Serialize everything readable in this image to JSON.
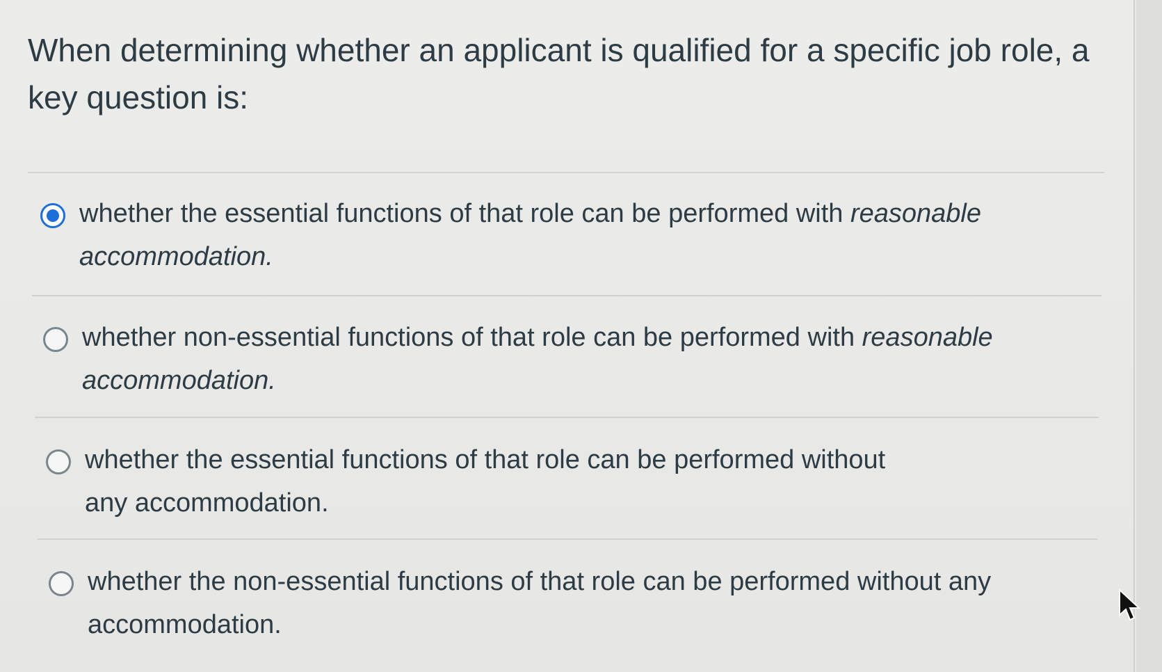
{
  "question": {
    "text": "When determining whether an applicant is qualified for a specific job role, a key question is:"
  },
  "answers": [
    {
      "selected": true,
      "text_before": "whether the essential functions of that role can be performed with ",
      "text_italic": "reasonable accommodation."
    },
    {
      "selected": false,
      "text_before": "whether non-essential functions of that role can be performed with ",
      "text_italic": "reasonable accommodation."
    },
    {
      "selected": false,
      "text_before": "whether the essential functions of that role can be performed without any accommodation.",
      "text_italic": ""
    },
    {
      "selected": false,
      "text_before": "whether the non-essential functions of that role can be performed without any accommodation.",
      "text_italic": ""
    }
  ],
  "colors": {
    "selected_radio": "#1b6fd6",
    "text": "#2d3b45"
  },
  "icons": {
    "radio_selected": "radio-selected-icon",
    "radio_unselected": "radio-unselected-icon",
    "cursor": "mouse-cursor-icon"
  }
}
